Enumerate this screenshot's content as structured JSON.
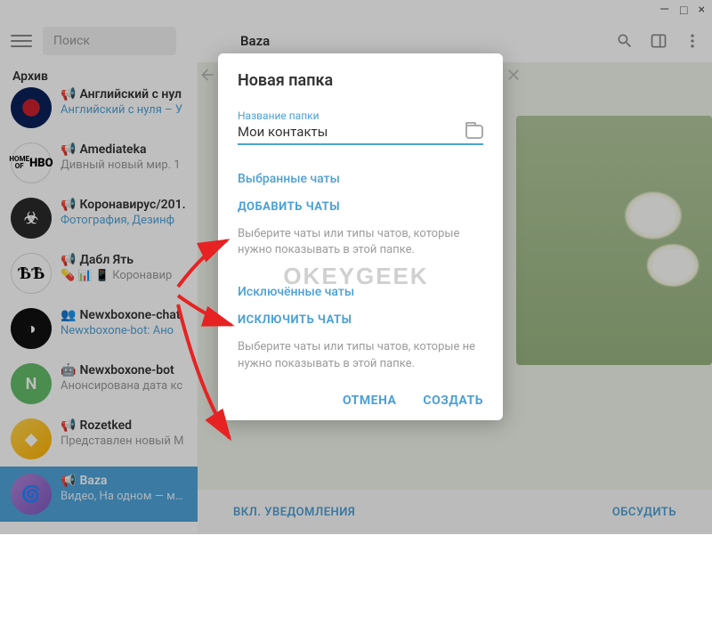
{
  "window": {
    "minimize": "—",
    "maximize": "□",
    "close": "×"
  },
  "header": {
    "search_placeholder": "Поиск",
    "chat_title": "Baza"
  },
  "archive_label": "Архив",
  "chats": [
    {
      "name": "Английский с нул",
      "preview": "Английский с нуля – У"
    },
    {
      "name": "Amediateka",
      "preview": "Дивный новый мир. 1"
    },
    {
      "name": "Коронавирус/201.",
      "preview": "Фотография, Дезинф"
    },
    {
      "name": "Дабл Ять",
      "preview": "💊 📊 📱 Коронавир"
    },
    {
      "name": "Newxboxone-chat",
      "preview": "Newxboxone-bot: Ано"
    },
    {
      "name": "Newxboxone-bot",
      "preview": "Анонсирована дата кс"
    },
    {
      "name": "Rozetked",
      "preview": "Представлен новый M"
    },
    {
      "name": "Baza",
      "preview": "Видео, На одном — мощная"
    }
  ],
  "modal": {
    "title": "Новая папка",
    "field_label": "Название папки",
    "field_value": "Мои контакты",
    "selected_title": "Выбранные чаты",
    "add_action": "ДОБАВИТЬ ЧАТЫ",
    "selected_desc": "Выберите чаты или типы чатов, которые нужно показывать в этой папке.",
    "excluded_title": "Исключённые чаты",
    "exclude_action": "ИСКЛЮЧИТЬ ЧАТЫ",
    "excluded_desc": "Выберите чаты или типы чатов, которые не нужно показывать в этой папке.",
    "cancel": "ОТМЕНА",
    "create": "СОЗДАТЬ"
  },
  "bottom": {
    "notifications": "ВКЛ. УВЕДОМЛЕНИЯ",
    "discuss": "ОБСУДИТЬ"
  },
  "watermark": "OKEYGEEK"
}
